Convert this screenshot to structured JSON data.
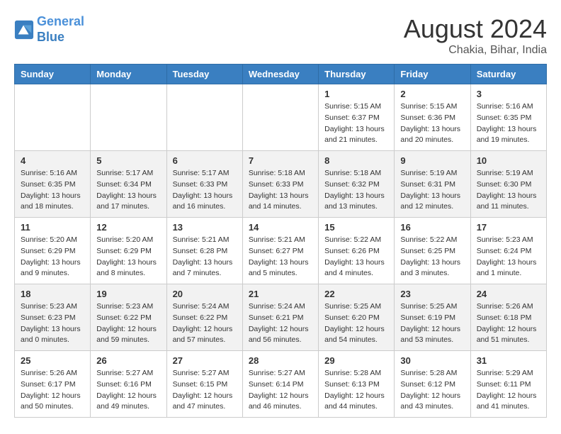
{
  "header": {
    "logo_line1": "General",
    "logo_line2": "Blue",
    "month_year": "August 2024",
    "location": "Chakia, Bihar, India"
  },
  "days_of_week": [
    "Sunday",
    "Monday",
    "Tuesday",
    "Wednesday",
    "Thursday",
    "Friday",
    "Saturday"
  ],
  "weeks": [
    [
      {
        "day": "",
        "info": ""
      },
      {
        "day": "",
        "info": ""
      },
      {
        "day": "",
        "info": ""
      },
      {
        "day": "",
        "info": ""
      },
      {
        "day": "1",
        "info": "Sunrise: 5:15 AM\nSunset: 6:37 PM\nDaylight: 13 hours\nand 21 minutes."
      },
      {
        "day": "2",
        "info": "Sunrise: 5:15 AM\nSunset: 6:36 PM\nDaylight: 13 hours\nand 20 minutes."
      },
      {
        "day": "3",
        "info": "Sunrise: 5:16 AM\nSunset: 6:35 PM\nDaylight: 13 hours\nand 19 minutes."
      }
    ],
    [
      {
        "day": "4",
        "info": "Sunrise: 5:16 AM\nSunset: 6:35 PM\nDaylight: 13 hours\nand 18 minutes."
      },
      {
        "day": "5",
        "info": "Sunrise: 5:17 AM\nSunset: 6:34 PM\nDaylight: 13 hours\nand 17 minutes."
      },
      {
        "day": "6",
        "info": "Sunrise: 5:17 AM\nSunset: 6:33 PM\nDaylight: 13 hours\nand 16 minutes."
      },
      {
        "day": "7",
        "info": "Sunrise: 5:18 AM\nSunset: 6:33 PM\nDaylight: 13 hours\nand 14 minutes."
      },
      {
        "day": "8",
        "info": "Sunrise: 5:18 AM\nSunset: 6:32 PM\nDaylight: 13 hours\nand 13 minutes."
      },
      {
        "day": "9",
        "info": "Sunrise: 5:19 AM\nSunset: 6:31 PM\nDaylight: 13 hours\nand 12 minutes."
      },
      {
        "day": "10",
        "info": "Sunrise: 5:19 AM\nSunset: 6:30 PM\nDaylight: 13 hours\nand 11 minutes."
      }
    ],
    [
      {
        "day": "11",
        "info": "Sunrise: 5:20 AM\nSunset: 6:29 PM\nDaylight: 13 hours\nand 9 minutes."
      },
      {
        "day": "12",
        "info": "Sunrise: 5:20 AM\nSunset: 6:29 PM\nDaylight: 13 hours\nand 8 minutes."
      },
      {
        "day": "13",
        "info": "Sunrise: 5:21 AM\nSunset: 6:28 PM\nDaylight: 13 hours\nand 7 minutes."
      },
      {
        "day": "14",
        "info": "Sunrise: 5:21 AM\nSunset: 6:27 PM\nDaylight: 13 hours\nand 5 minutes."
      },
      {
        "day": "15",
        "info": "Sunrise: 5:22 AM\nSunset: 6:26 PM\nDaylight: 13 hours\nand 4 minutes."
      },
      {
        "day": "16",
        "info": "Sunrise: 5:22 AM\nSunset: 6:25 PM\nDaylight: 13 hours\nand 3 minutes."
      },
      {
        "day": "17",
        "info": "Sunrise: 5:23 AM\nSunset: 6:24 PM\nDaylight: 13 hours\nand 1 minute."
      }
    ],
    [
      {
        "day": "18",
        "info": "Sunrise: 5:23 AM\nSunset: 6:23 PM\nDaylight: 13 hours\nand 0 minutes."
      },
      {
        "day": "19",
        "info": "Sunrise: 5:23 AM\nSunset: 6:22 PM\nDaylight: 12 hours\nand 59 minutes."
      },
      {
        "day": "20",
        "info": "Sunrise: 5:24 AM\nSunset: 6:22 PM\nDaylight: 12 hours\nand 57 minutes."
      },
      {
        "day": "21",
        "info": "Sunrise: 5:24 AM\nSunset: 6:21 PM\nDaylight: 12 hours\nand 56 minutes."
      },
      {
        "day": "22",
        "info": "Sunrise: 5:25 AM\nSunset: 6:20 PM\nDaylight: 12 hours\nand 54 minutes."
      },
      {
        "day": "23",
        "info": "Sunrise: 5:25 AM\nSunset: 6:19 PM\nDaylight: 12 hours\nand 53 minutes."
      },
      {
        "day": "24",
        "info": "Sunrise: 5:26 AM\nSunset: 6:18 PM\nDaylight: 12 hours\nand 51 minutes."
      }
    ],
    [
      {
        "day": "25",
        "info": "Sunrise: 5:26 AM\nSunset: 6:17 PM\nDaylight: 12 hours\nand 50 minutes."
      },
      {
        "day": "26",
        "info": "Sunrise: 5:27 AM\nSunset: 6:16 PM\nDaylight: 12 hours\nand 49 minutes."
      },
      {
        "day": "27",
        "info": "Sunrise: 5:27 AM\nSunset: 6:15 PM\nDaylight: 12 hours\nand 47 minutes."
      },
      {
        "day": "28",
        "info": "Sunrise: 5:27 AM\nSunset: 6:14 PM\nDaylight: 12 hours\nand 46 minutes."
      },
      {
        "day": "29",
        "info": "Sunrise: 5:28 AM\nSunset: 6:13 PM\nDaylight: 12 hours\nand 44 minutes."
      },
      {
        "day": "30",
        "info": "Sunrise: 5:28 AM\nSunset: 6:12 PM\nDaylight: 12 hours\nand 43 minutes."
      },
      {
        "day": "31",
        "info": "Sunrise: 5:29 AM\nSunset: 6:11 PM\nDaylight: 12 hours\nand 41 minutes."
      }
    ]
  ]
}
